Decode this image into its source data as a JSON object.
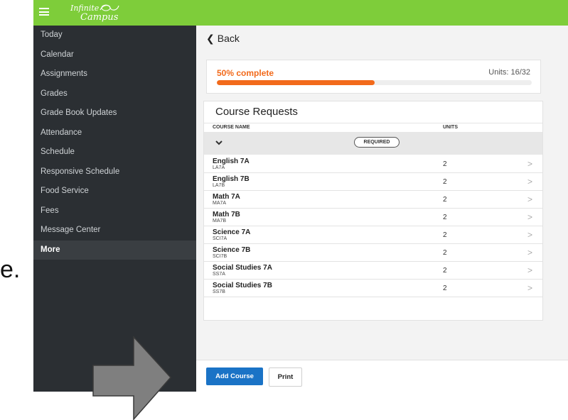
{
  "stray_text": "e.",
  "logo": {
    "line1": "Infinite",
    "line2": "Campus"
  },
  "sidebar": {
    "items": [
      {
        "label": "Today"
      },
      {
        "label": "Calendar"
      },
      {
        "label": "Assignments"
      },
      {
        "label": "Grades"
      },
      {
        "label": "Grade Book Updates"
      },
      {
        "label": "Attendance"
      },
      {
        "label": "Schedule"
      },
      {
        "label": "Responsive Schedule"
      },
      {
        "label": "Food Service"
      },
      {
        "label": "Fees"
      },
      {
        "label": "Message Center"
      },
      {
        "label": "More"
      }
    ],
    "active_index": 11
  },
  "back": {
    "label": "Back"
  },
  "progress": {
    "label": "50% complete",
    "units_text": "Units: 16/32",
    "fraction": 0.5
  },
  "course_requests": {
    "title": "Course Requests",
    "columns": {
      "name": "COURSE NAME",
      "units": "UNITS"
    },
    "group_badge": "REQUIRED",
    "rows": [
      {
        "name": "English 7A",
        "code": "LA7A",
        "units": "2"
      },
      {
        "name": "English 7B",
        "code": "LA7B",
        "units": "2"
      },
      {
        "name": "Math 7A",
        "code": "MA7A",
        "units": "2"
      },
      {
        "name": "Math 7B",
        "code": "MA7B",
        "units": "2"
      },
      {
        "name": "Science 7A",
        "code": "SCI7A",
        "units": "2"
      },
      {
        "name": "Science 7B",
        "code": "SCI7B",
        "units": "2"
      },
      {
        "name": "Social Studies 7A",
        "code": "SS7A",
        "units": "2"
      },
      {
        "name": "Social Studies 7B",
        "code": "SS7B",
        "units": "2"
      }
    ]
  },
  "footer": {
    "add_label": "Add Course",
    "print_label": "Print"
  },
  "colors": {
    "topbar": "#7ecd3a",
    "sidebar": "#2b2f33",
    "accent_orange": "#f26a1b",
    "primary_blue": "#1a73c6",
    "annotation_arrow": "#7f7f7f"
  },
  "icons": {
    "menu": "hamburger-icon",
    "back": "chevron-left-icon",
    "group": "chevron-down-icon",
    "row": "chevron-right-icon",
    "annotation": "arrow-right-icon"
  }
}
